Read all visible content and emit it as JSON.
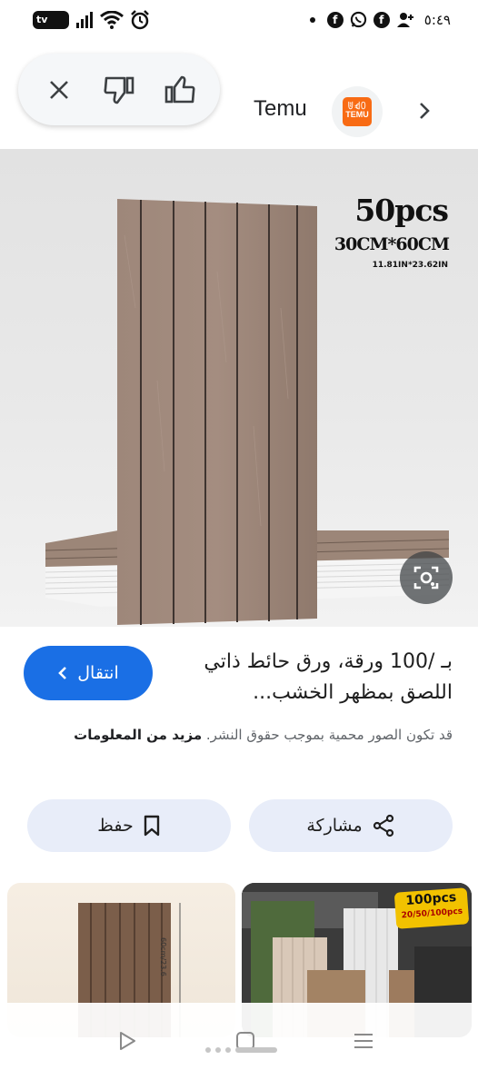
{
  "status_bar": {
    "time": "٥:٤٩",
    "tv_label": "tv",
    "icons": [
      "tv-badge",
      "signal-icon",
      "wifi-icon",
      "alarm-icon",
      "notification-dot",
      "facebook-icon",
      "whatsapp-icon",
      "facebook-icon",
      "person-add-icon"
    ]
  },
  "feedback": {
    "icons": [
      "close-icon",
      "thumbs-down-icon",
      "thumbs-up-icon"
    ]
  },
  "source": {
    "name": "Temu",
    "logo_line1": "ꂹꃹꄲ",
    "logo_line2": "TEMU",
    "brand_color": "#f86b14"
  },
  "main_image": {
    "pcs": "50pcs",
    "size_cm": "30CM*60CM",
    "size_in": "11.81IN*23.62IN"
  },
  "result": {
    "visit_label": "انتقال",
    "title": "بـ /100 ورقة، ورق حائط ذاتي اللصق بمظهر الخشب...",
    "copyright": "قد تكون الصور محمية بموجب حقوق النشر.",
    "more_info": "مزيد من المعلومات",
    "accent_color": "#1a6fe5"
  },
  "actions": {
    "save_label": "حفظ",
    "share_label": "مشاركة"
  },
  "related": {
    "left_dim_label": "60cm/23.6",
    "right_badge_main": "100pcs",
    "right_badge_sub": "20/50/100pcs"
  },
  "nav": {
    "icons": [
      "back-icon",
      "home-icon",
      "recents-icon"
    ]
  }
}
